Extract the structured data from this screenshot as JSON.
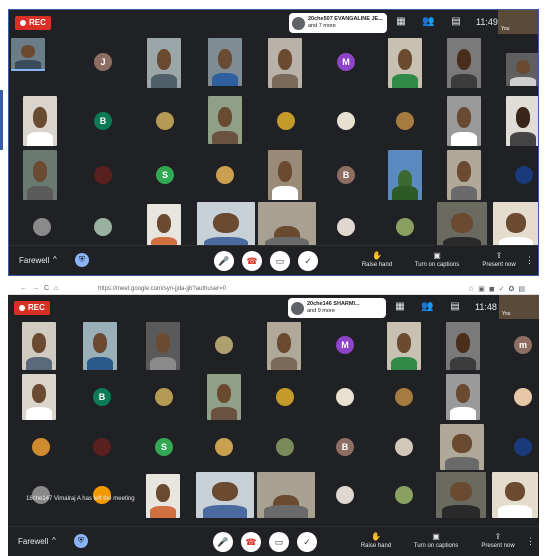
{
  "top": {
    "rec_label": "REC",
    "speaker_name": "20che507 EVANGALINE JE...",
    "speaker_more": "and 7 more",
    "time": "11:49 AM",
    "meeting_name": "Farewell",
    "actions": {
      "raise_hand": "Raise hand",
      "captions": "Turn on captions",
      "present": "Present now"
    },
    "self_label": "You"
  },
  "bottom": {
    "url": "https://meet.google.com/syn-jjda-jjb?authuser=0",
    "rec_label": "REC",
    "speaker_name": "20che146 SHARMI...",
    "speaker_more": "and 9 more",
    "time": "11:48 AM",
    "notification": "18che147 Vimalraj A has left the meeting",
    "meeting_name": "Farewell",
    "actions": {
      "raise_hand": "Raise hand",
      "captions": "Turn on captions",
      "present": "Present now"
    },
    "self_label": "You"
  },
  "letters": {
    "J": "J",
    "M": "M",
    "B": "B",
    "S": "S",
    "m": "m"
  },
  "colors": {
    "meet_bg": "#202124",
    "rec_red": "#d93025",
    "avatar_purple": "#8e44c9",
    "avatar_green": "#33a852",
    "avatar_teal": "#0b7a55",
    "avatar_brown": "#8d6e63",
    "avatar_orange": "#f29900"
  }
}
